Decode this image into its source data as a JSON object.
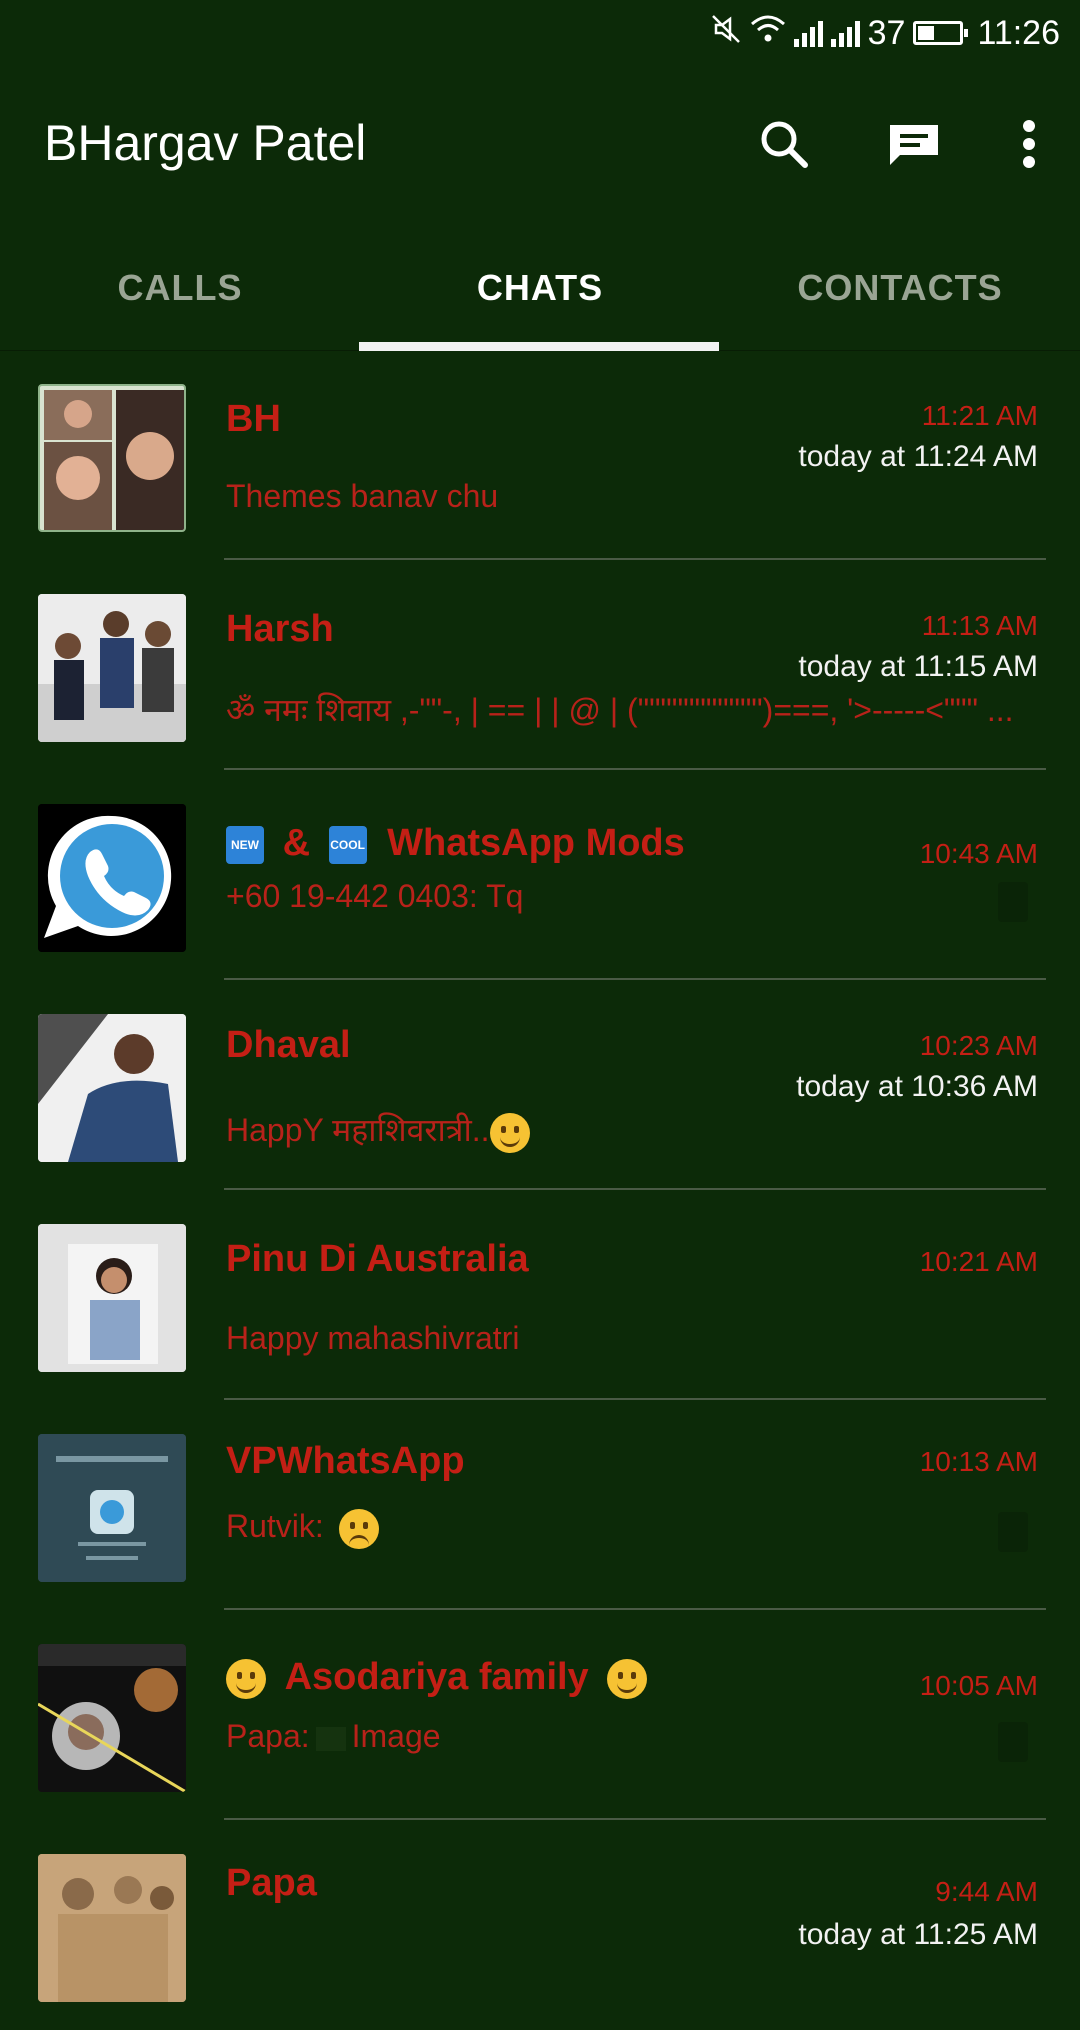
{
  "status_bar": {
    "battery": "37",
    "time": "11:26"
  },
  "app": {
    "title": "BHargav Patel"
  },
  "tabs": [
    {
      "label": "CALLS"
    },
    {
      "label": "CHATS"
    },
    {
      "label": "CONTACTS"
    }
  ],
  "chats": [
    {
      "name": "BH",
      "time": "11:21 AM",
      "seen": "today at 11:24 AM",
      "message": "Themes banav chu"
    },
    {
      "name": "Harsh",
      "time": "11:13 AM",
      "seen": "today at 11:15 AM",
      "message": "ॐ नमः शिवाय ,-\"\"-, | == | | @ | (\"\"\"\"\"\"\"\"\"\"\")===, '>-----<\"\"\" ..."
    },
    {
      "name_prefix_badge": "NEW",
      "name_mid": "&",
      "name_badge2": "COOL",
      "name": "WhatsApp Mods",
      "time": "10:43 AM",
      "message": "+60 19-442 0403: Tq"
    },
    {
      "name": "Dhaval",
      "time": "10:23 AM",
      "seen": "today at 10:36 AM",
      "message": "HappY महाशिवरात्री.."
    },
    {
      "name": "Pinu Di Australia",
      "time": "10:21 AM",
      "message": "Happy mahashivratri"
    },
    {
      "name": "VPWhatsApp",
      "time": "10:13 AM",
      "message": "Rutvik:"
    },
    {
      "name": "Asodariya family",
      "time": "10:05 AM",
      "message_prefix": "Papa:",
      "message": "Image"
    },
    {
      "name": "Papa",
      "time": "9:44 AM",
      "seen": "today at 11:25 AM"
    }
  ],
  "colors": {
    "background": "#0c2a08",
    "accent_red": "#c41f15",
    "tab_indicator": "#f2f2f2"
  }
}
